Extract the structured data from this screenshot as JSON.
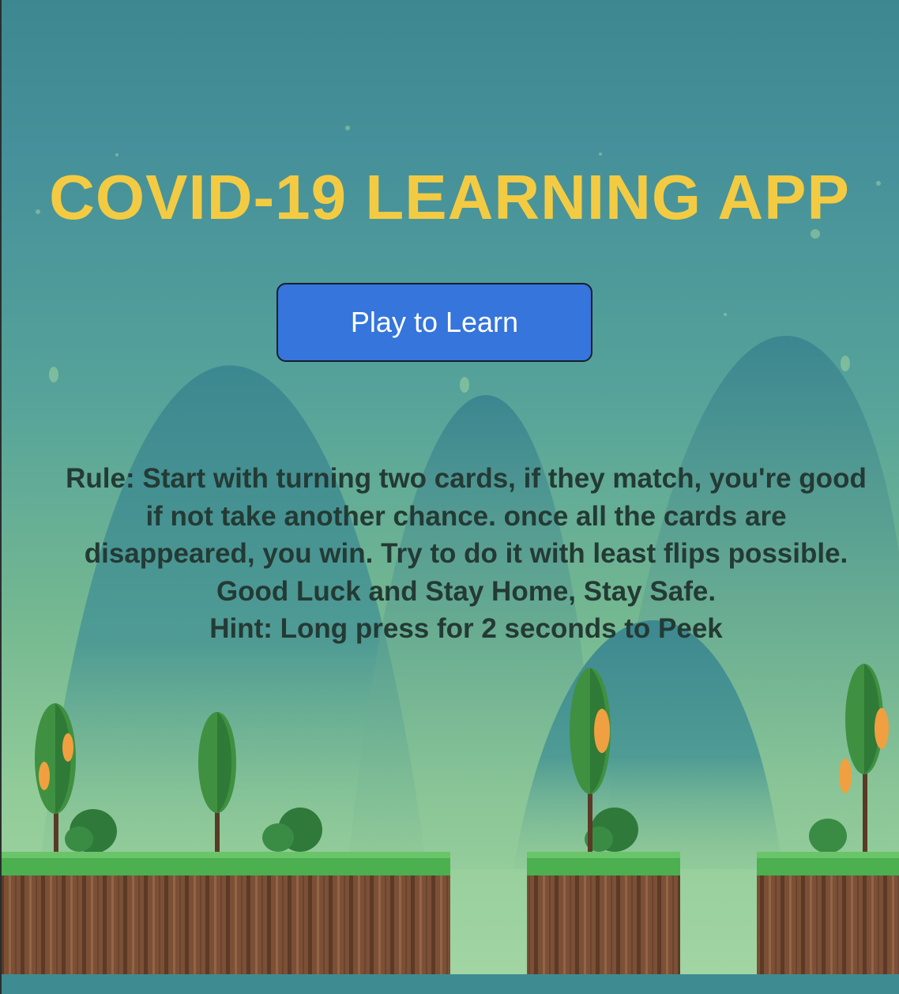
{
  "app": {
    "title": "COVID-19 LEARNING APP",
    "play_button_label": "Play to Learn"
  },
  "instructions": {
    "rule": "Rule: Start with turning two cards, if they match, you're good if not take another chance. once all the cards are disappeared, you win. Try to do it with least flips possible. Good Luck and Stay Home, Stay Safe.",
    "hint": "Hint: Long press for 2 seconds to Peek"
  },
  "colors": {
    "title": "#f3cb43",
    "button": "#3575dc",
    "button_text": "#ffffff",
    "rule_text": "#243a34",
    "grass": "#4caf50",
    "dirt": "#7e5439"
  }
}
